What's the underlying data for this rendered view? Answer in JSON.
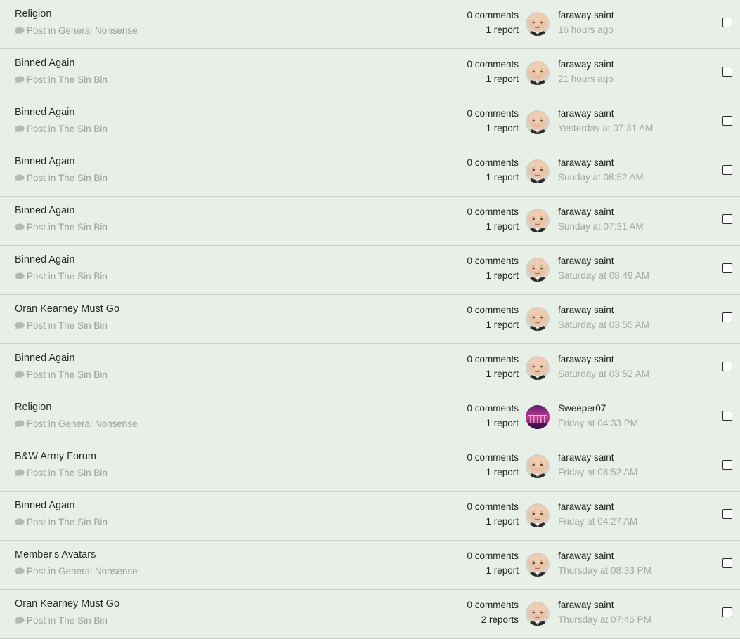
{
  "reports": [
    {
      "title": "Religion",
      "type": "Post in",
      "forum": "General Nonsense",
      "comments": "0 comments",
      "reports": "1 report",
      "user": "faraway saint",
      "avatar": "boss-baby-avatar",
      "time": "16 hours ago",
      "checked": false
    },
    {
      "title": "Binned Again",
      "type": "Post in",
      "forum": "The Sin Bin",
      "comments": "0 comments",
      "reports": "1 report",
      "user": "faraway saint",
      "avatar": "boss-baby-avatar",
      "time": "21 hours ago",
      "checked": false
    },
    {
      "title": "Binned Again",
      "type": "Post in",
      "forum": "The Sin Bin",
      "comments": "0 comments",
      "reports": "1 report",
      "user": "faraway saint",
      "avatar": "boss-baby-avatar",
      "time": "Yesterday at 07:31 AM",
      "checked": false
    },
    {
      "title": "Binned Again",
      "type": "Post in",
      "forum": "The Sin Bin",
      "comments": "0 comments",
      "reports": "1 report",
      "user": "faraway saint",
      "avatar": "boss-baby-avatar",
      "time": "Sunday at 08:52 AM",
      "checked": false
    },
    {
      "title": "Binned Again",
      "type": "Post in",
      "forum": "The Sin Bin",
      "comments": "0 comments",
      "reports": "1 report",
      "user": "faraway saint",
      "avatar": "boss-baby-avatar",
      "time": "Sunday at 07:31 AM",
      "checked": false
    },
    {
      "title": "Binned Again",
      "type": "Post in",
      "forum": "The Sin Bin",
      "comments": "0 comments",
      "reports": "1 report",
      "user": "faraway saint",
      "avatar": "boss-baby-avatar",
      "time": "Saturday at 08:49 AM",
      "checked": false
    },
    {
      "title": "Oran Kearney Must Go",
      "type": "Post in",
      "forum": "The Sin Bin",
      "comments": "0 comments",
      "reports": "1 report",
      "user": "faraway saint",
      "avatar": "boss-baby-avatar",
      "time": "Saturday at 03:55 AM",
      "checked": false
    },
    {
      "title": "Binned Again",
      "type": "Post in",
      "forum": "The Sin Bin",
      "comments": "0 comments",
      "reports": "1 report",
      "user": "faraway saint",
      "avatar": "boss-baby-avatar",
      "time": "Saturday at 03:52 AM",
      "checked": false
    },
    {
      "title": "Religion",
      "type": "Post in",
      "forum": "General Nonsense",
      "comments": "0 comments",
      "reports": "1 report",
      "user": "Sweeper07",
      "avatar": "purple-pier-avatar",
      "time": "Friday at 04:33 PM",
      "checked": false
    },
    {
      "title": "B&W Army Forum",
      "type": "Post in",
      "forum": "The Sin Bin",
      "comments": "0 comments",
      "reports": "1 report",
      "user": "faraway saint",
      "avatar": "boss-baby-avatar",
      "time": "Friday at 08:52 AM",
      "checked": false
    },
    {
      "title": "Binned Again",
      "type": "Post in",
      "forum": "The Sin Bin",
      "comments": "0 comments",
      "reports": "1 report",
      "user": "faraway saint",
      "avatar": "boss-baby-avatar",
      "time": "Friday at 04:27 AM",
      "checked": false
    },
    {
      "title": "Member's Avatars",
      "type": "Post in",
      "forum": "General Nonsense",
      "comments": "0 comments",
      "reports": "1 report",
      "user": "faraway saint",
      "avatar": "boss-baby-avatar",
      "time": "Thursday at 08:33 PM",
      "checked": false
    },
    {
      "title": "Oran Kearney Must Go",
      "type": "Post in",
      "forum": "The Sin Bin",
      "comments": "0 comments",
      "reports": "2 reports",
      "user": "faraway saint",
      "avatar": "boss-baby-avatar",
      "time": "Thursday at 07:46 PM",
      "checked": false
    }
  ],
  "colors": {
    "background": "#e7efe6",
    "divider": "#c6cfc5",
    "muted_text": "#9aa09a",
    "comment_icon": "#b4b9b4"
  },
  "icons": {
    "meta_icon": "comment-icon"
  }
}
